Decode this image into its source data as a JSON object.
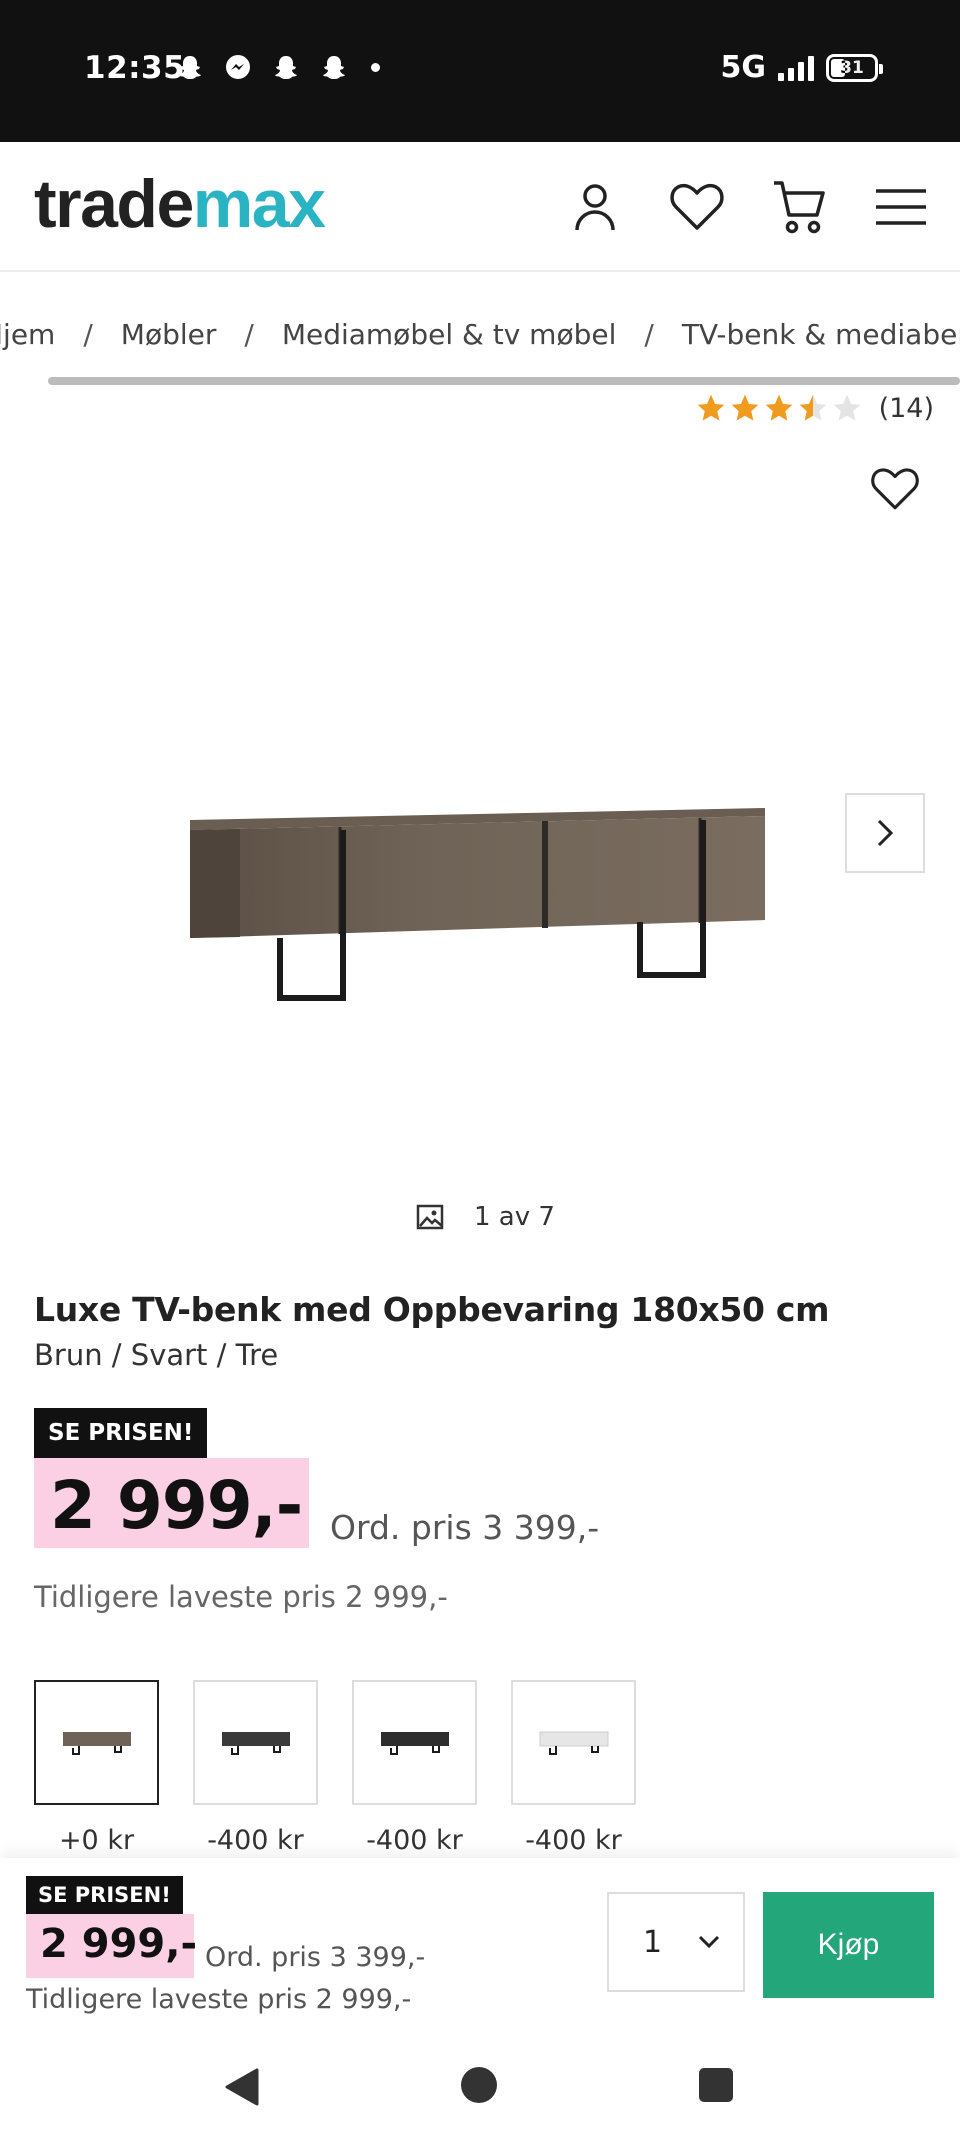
{
  "status_bar": {
    "time": "12:35",
    "network": "5G",
    "battery": "31",
    "icons": [
      "snapchat-icon",
      "messenger-icon",
      "snapchat-icon",
      "snapchat-icon"
    ]
  },
  "header": {
    "logo_part1": "trade",
    "logo_part2": "max",
    "icons": [
      "user-icon",
      "heart-icon",
      "cart-icon",
      "menu-icon"
    ],
    "brand_color": "#2ab3c3"
  },
  "breadcrumb": {
    "items": [
      "Hjem",
      "Møbler",
      "Mediamøbel & tv møbel",
      "TV-benk & mediabenk"
    ],
    "separator": "/"
  },
  "rating": {
    "stars": 3.5,
    "count": "(14)",
    "star_color": "#f09a1e"
  },
  "gallery": {
    "counter": "1 av 7"
  },
  "product": {
    "title": "Luxe TV-benk med Oppbevaring 180x50 cm",
    "subtitle": "Brun / Svart / Tre",
    "badge": "SE PRISEN!",
    "price": "2 999,-",
    "ord_price": "Ord. pris 3 399,-",
    "prev_price": "Tidligere laveste pris 2 999,-",
    "price_highlight_color": "#fcd0e4"
  },
  "variants": [
    {
      "price": "+0 kr",
      "selected": true,
      "color": "#6f6357"
    },
    {
      "price": "-400 kr",
      "selected": false,
      "color": "#3a3a3a"
    },
    {
      "price": "-400 kr",
      "selected": false,
      "color": "#2e2e2e"
    },
    {
      "price": "-400 kr",
      "selected": false,
      "color": "#e6e6e6"
    }
  ],
  "sticky_bar": {
    "badge": "SE PRISEN!",
    "price": "2 999,-",
    "ord_price": "Ord. pris 3 399,-",
    "prev_price": "Tidligere laveste pris 2 999,-",
    "quantity": "1",
    "buy_label": "Kjøp",
    "buy_color": "#22a67a"
  }
}
